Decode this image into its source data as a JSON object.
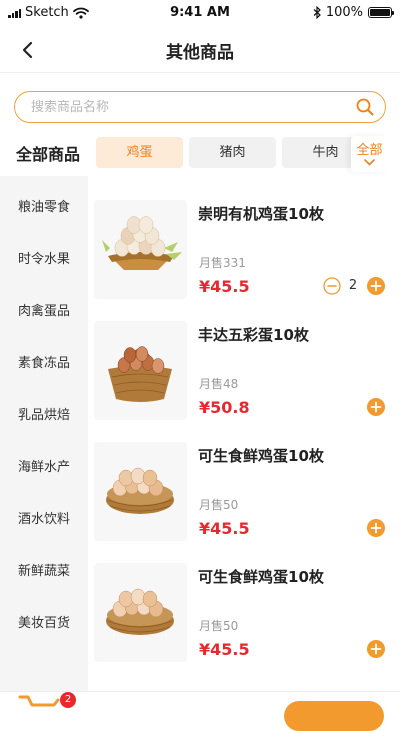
{
  "status_bar": {
    "carrier": "Sketch",
    "time": "9:41 AM",
    "battery": "100%"
  },
  "nav": {
    "title": "其他商品"
  },
  "search": {
    "placeholder": "搜索商品名称"
  },
  "category": {
    "title": "全部商品",
    "chips": [
      "鸡蛋",
      "猪肉",
      "牛肉"
    ],
    "active_chip": "鸡蛋",
    "all_label": "全部"
  },
  "sidebar": {
    "items": [
      "粮油零食",
      "时令水果",
      "肉禽蛋品",
      "素食冻品",
      "乳品烘焙",
      "海鲜水产",
      "酒水饮料",
      "新鲜蔬菜",
      "美妆百货"
    ]
  },
  "products": [
    {
      "name": "崇明有机鸡蛋10枚",
      "sales": "月售331",
      "price": "¥45.5",
      "quantity": "2"
    },
    {
      "name": "丰达五彩蛋10枚",
      "sales": "月售48",
      "price": "¥50.8"
    },
    {
      "name": "可生食鲜鸡蛋10枚",
      "sales": "月售50",
      "price": "¥45.5"
    },
    {
      "name": "可生食鲜鸡蛋10枚",
      "sales": "月售50",
      "price": "¥45.5"
    }
  ],
  "cart": {
    "count": "2"
  },
  "colors": {
    "accent": "#f29a2e",
    "accent_text": "#f07f1a",
    "price": "#e8282e",
    "chip_active_bg": "#fdebd8"
  },
  "icons": [
    "back-icon",
    "search-icon",
    "chevron-down-icon",
    "add-icon",
    "minus-icon",
    "cart-icon",
    "wifi-icon",
    "bluetooth-icon",
    "battery-icon"
  ]
}
